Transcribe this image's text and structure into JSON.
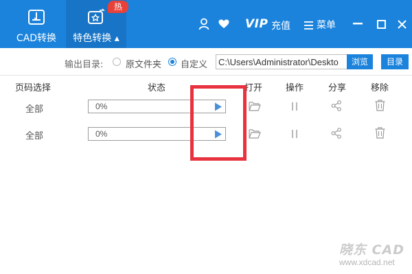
{
  "header": {
    "tabs": [
      {
        "label": "CAD转换",
        "icon": "cad-convert-icon"
      },
      {
        "label": "特色转换",
        "icon": "special-convert-icon",
        "active": true
      }
    ],
    "hot_badge": "热",
    "vip_label": "VIP",
    "recharge_label": "充值",
    "menu_label": "菜单",
    "colors": {
      "bar": "#1b83dc",
      "active_tab": "#1874c6",
      "badge": "#e8413a"
    }
  },
  "output": {
    "label": "输出目录:",
    "options": [
      {
        "label": "原文件夹",
        "checked": false
      },
      {
        "label": "自定义",
        "checked": true
      }
    ],
    "path_value": "C:\\Users\\Administrator\\Deskto",
    "browse_label": "浏览",
    "directory_label": "目录"
  },
  "table": {
    "columns": [
      "页码选择",
      "状态",
      "打开",
      "操作",
      "分享",
      "移除"
    ],
    "rows": [
      {
        "pages": "全部",
        "progress": "0%"
      },
      {
        "pages": "全部",
        "progress": "0%"
      }
    ]
  },
  "highlight_color": "#e8323f",
  "watermark": {
    "title": "晓东 CAD",
    "url": "www.xdcad.net"
  }
}
